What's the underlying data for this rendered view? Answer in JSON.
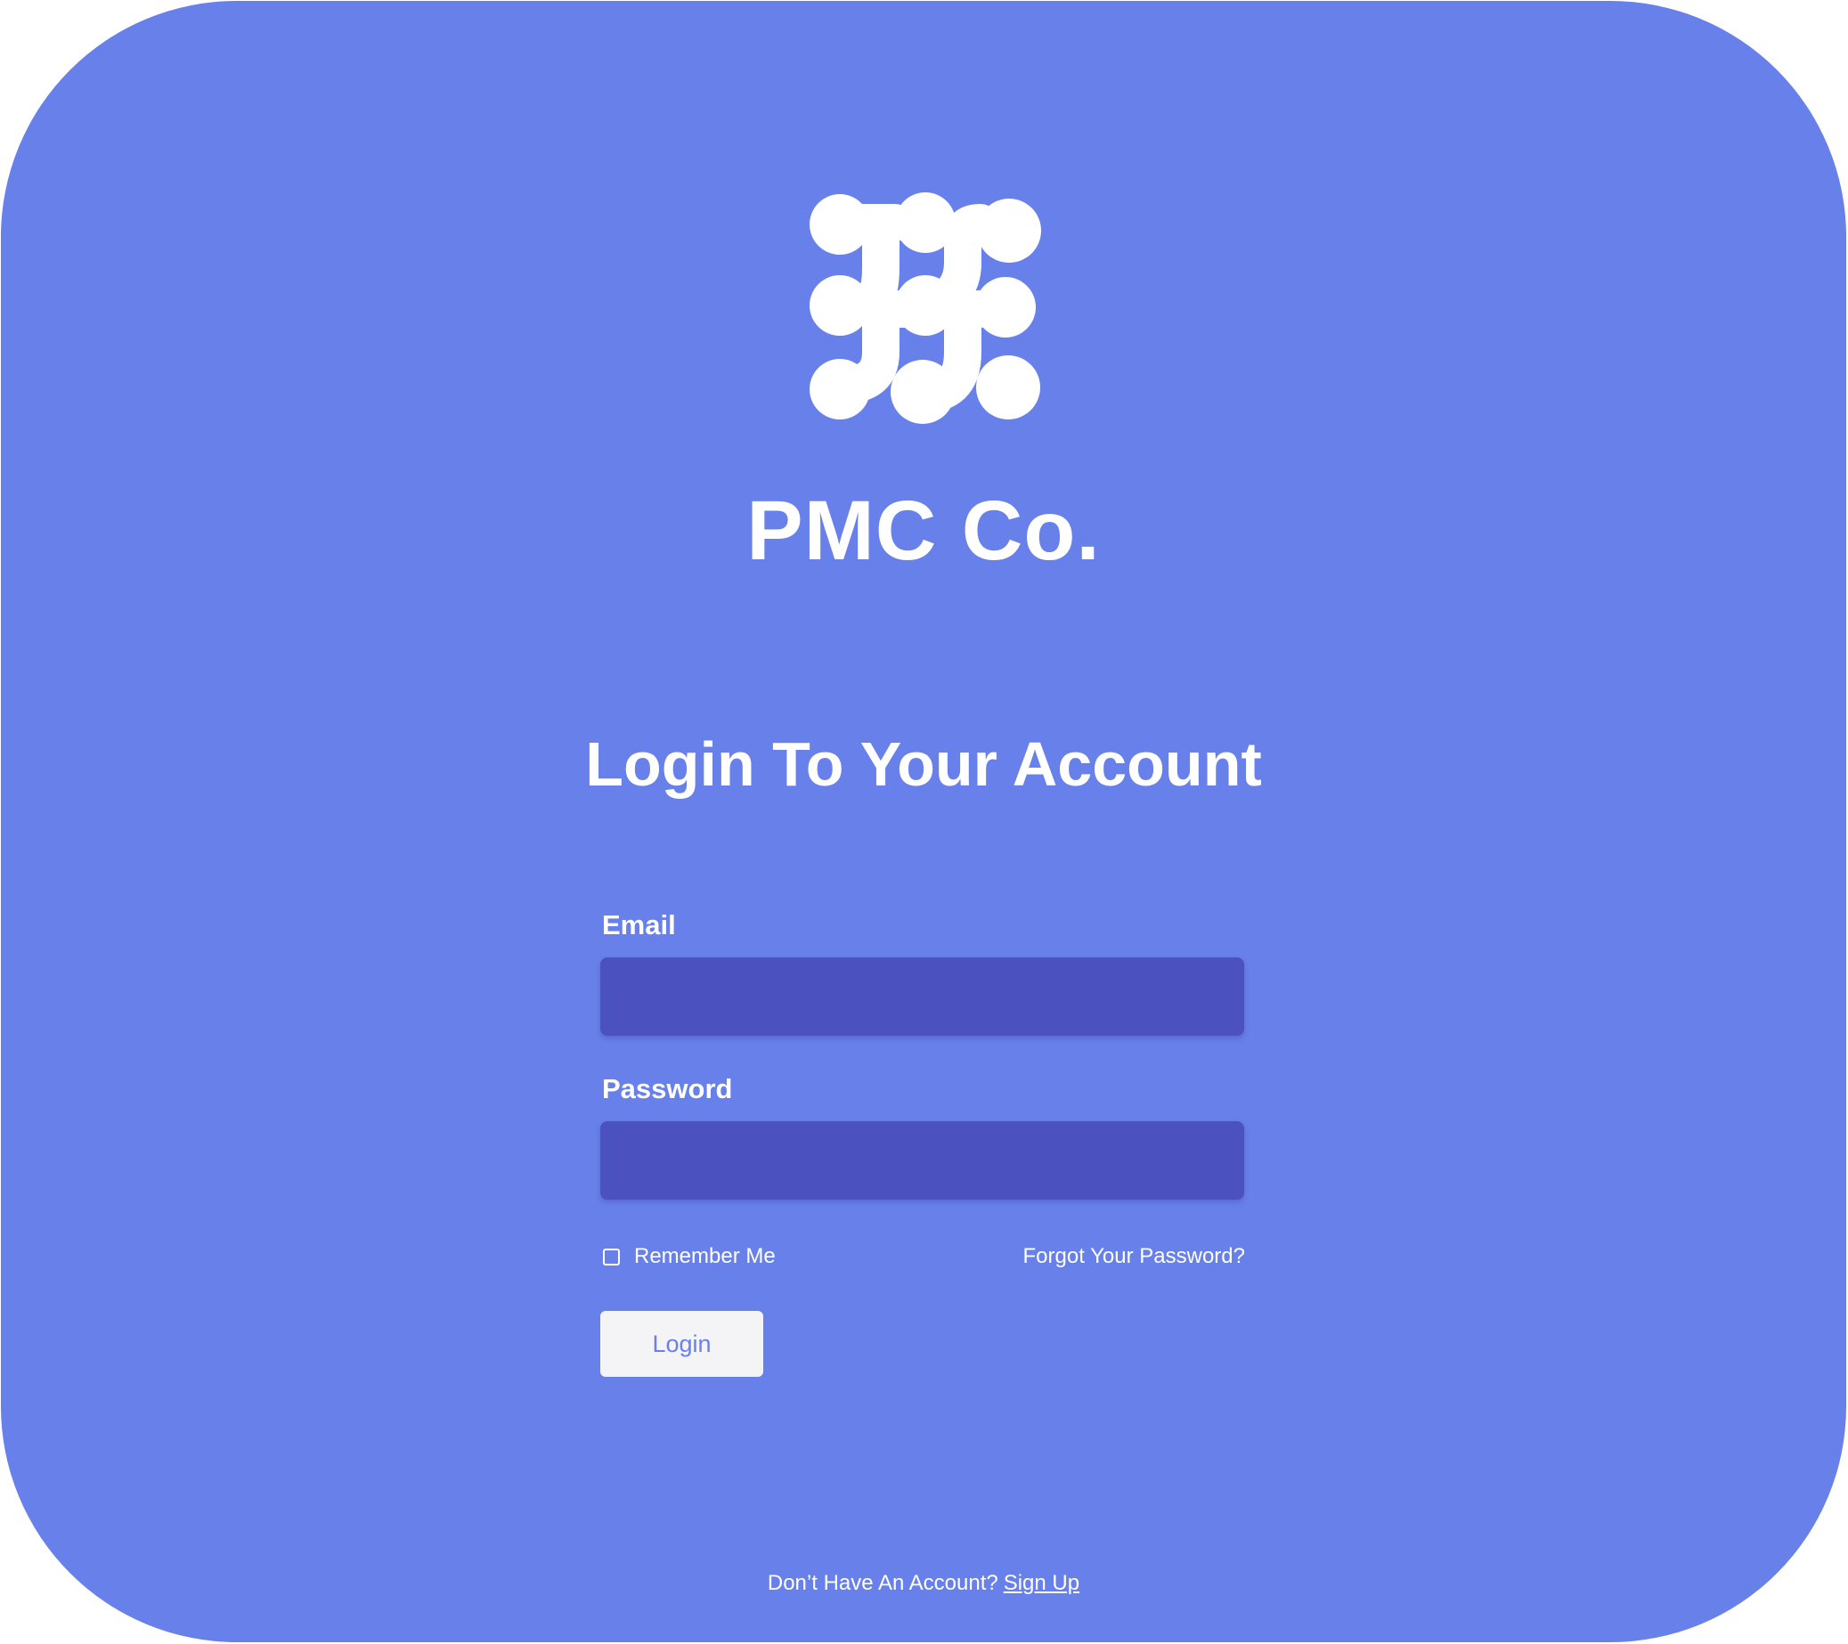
{
  "brand": {
    "name": "PMC Co.",
    "logo_icon": "pmc-network-dots-logo"
  },
  "form": {
    "title": "Login To Your Account",
    "email": {
      "label": "Email",
      "value": "",
      "placeholder": ""
    },
    "password": {
      "label": "Password",
      "value": "",
      "placeholder": ""
    },
    "remember_label": "Remember Me",
    "remember_checked": false,
    "forgot_label": "Forgot Your Password?",
    "login_label": "Login"
  },
  "footer": {
    "prompt": "Don’t Have An Account?",
    "signup_label": "Sign Up"
  },
  "colors": {
    "background": "#6880EA",
    "input_fill": "#4B51BE",
    "button_fill": "#F4F4F6",
    "text": "#FFFFFF"
  }
}
